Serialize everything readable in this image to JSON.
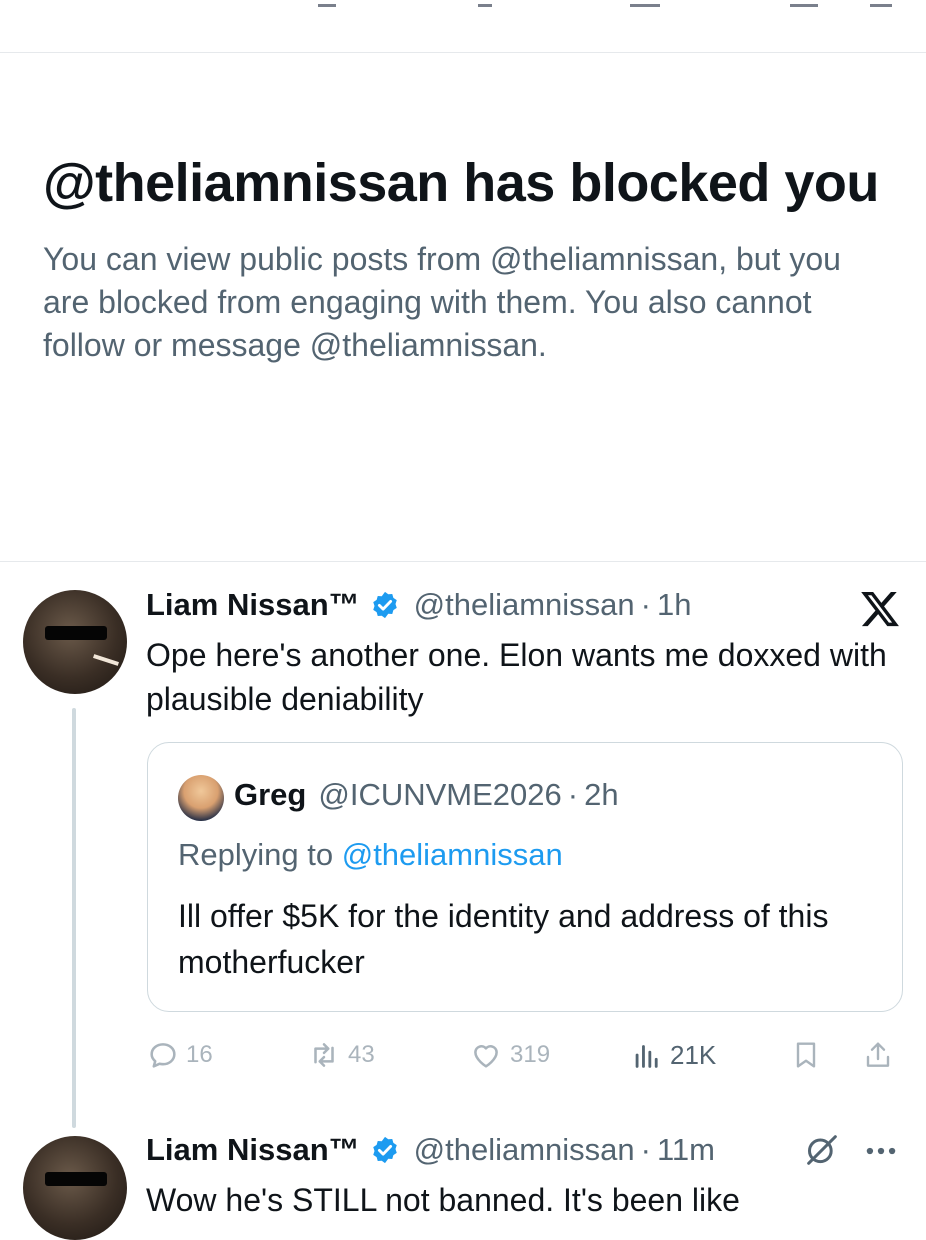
{
  "blocked_notice": {
    "title": "@theliamnissan has blocked you",
    "description": "You can view public posts from @theliamnissan, but you are blocked from engaging with them. You also cannot follow or message @theliamnissan."
  },
  "post1": {
    "author_name": "Liam Nissan™",
    "handle": "@theliamnissan",
    "separator": "·",
    "time": "1h",
    "text": "Ope here's another one. Elon wants me doxxed with plausible deniability",
    "quote": {
      "author_name": "Greg",
      "handle": "@ICUNVME2026",
      "separator": "·",
      "time": "2h",
      "replying_prefix": "Replying to",
      "replying_mention": "@theliamnissan",
      "text": "Ill offer $5K for the identity and address of this motherfucker"
    },
    "actions": {
      "replies": "16",
      "reposts": "43",
      "likes": "319",
      "views": "21K"
    }
  },
  "post2": {
    "author_name": "Liam Nissan™",
    "handle": "@theliamnissan",
    "separator": "·",
    "time": "11m",
    "text": "Wow he's STILL not banned. It's been like"
  },
  "colors": {
    "accent": "#1d9bf0",
    "verified": "#1d9bf0",
    "text_primary": "#0f1419",
    "text_secondary": "#536471",
    "border": "#cfd9de"
  }
}
